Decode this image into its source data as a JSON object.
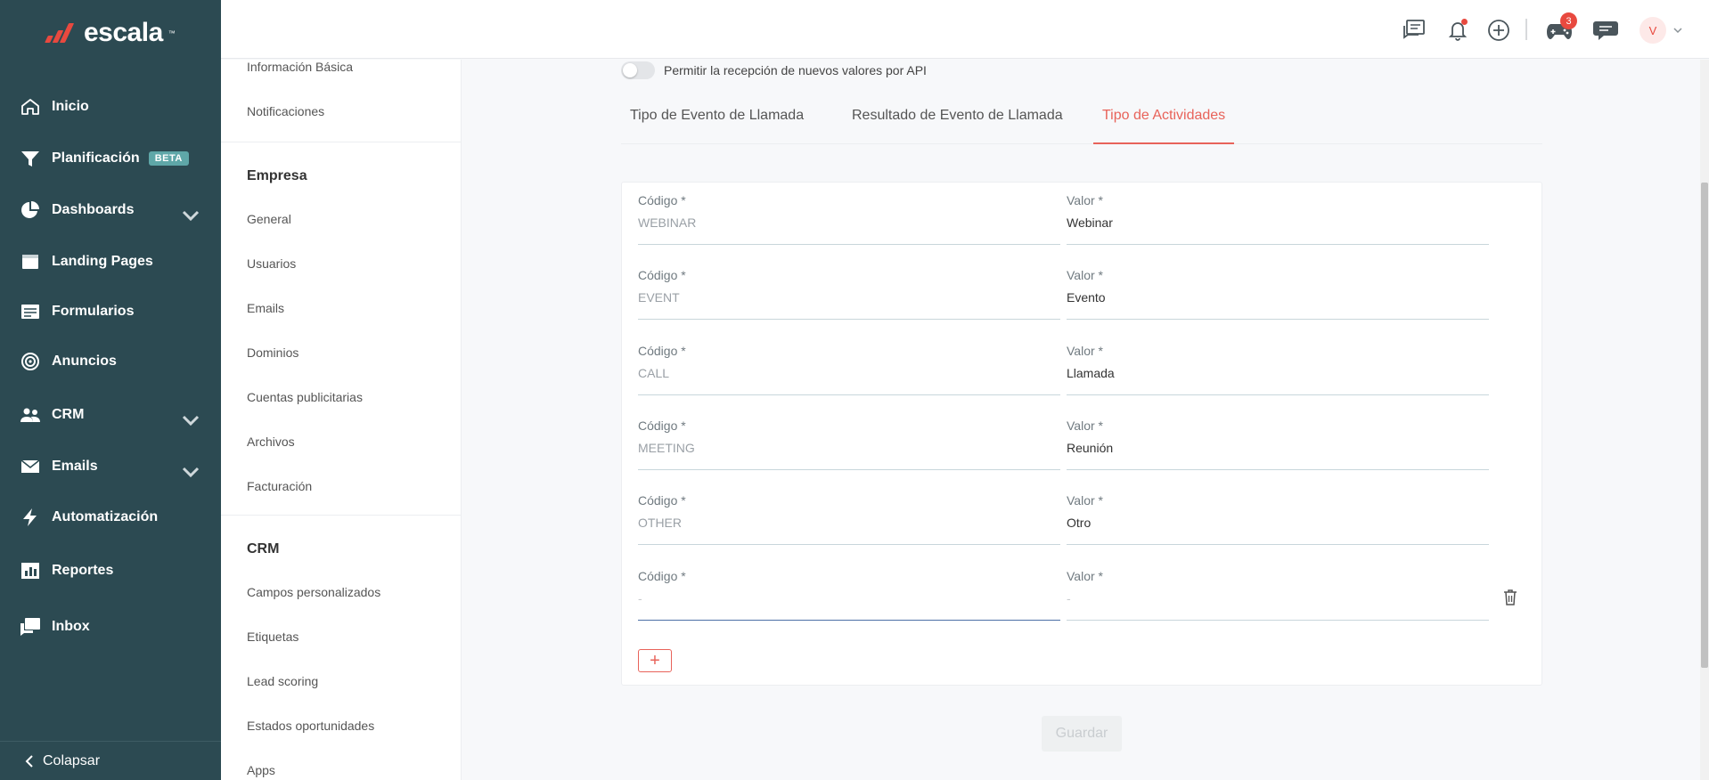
{
  "brand": {
    "name": "escala",
    "tm": "™",
    "accent": "#e8493f",
    "nav_bg": "#2c4a52"
  },
  "nav": {
    "items": [
      {
        "label": "Inicio",
        "icon": "home-icon"
      },
      {
        "label": "Planificación",
        "icon": "funnel-icon",
        "badge": "BETA"
      },
      {
        "label": "Dashboards",
        "icon": "pie-chart-icon",
        "expandable": true
      },
      {
        "label": "Landing Pages",
        "icon": "landing-page-icon"
      },
      {
        "label": "Formularios",
        "icon": "form-icon"
      },
      {
        "label": "Anuncios",
        "icon": "target-icon"
      },
      {
        "label": "CRM",
        "icon": "people-icon",
        "expandable": true
      },
      {
        "label": "Emails",
        "icon": "envelope-icon",
        "expandable": true
      },
      {
        "label": "Automatización",
        "icon": "lightning-icon"
      },
      {
        "label": "Reportes",
        "icon": "bar-chart-icon"
      },
      {
        "label": "Inbox",
        "icon": "chat-bubbles-icon"
      }
    ],
    "collapse_label": "Colapsar"
  },
  "topbar": {
    "icons": [
      "messages-icon",
      "bell-icon",
      "plus-circle-icon",
      "gamepad-icon",
      "support-chat-icon"
    ],
    "gamepad_count": "3",
    "avatar_initial": "V"
  },
  "subnav": {
    "top_items": [
      "Información Básica",
      "Notificaciones"
    ],
    "empresa_heading": "Empresa",
    "empresa_items": [
      "General",
      "Usuarios",
      "Emails",
      "Dominios",
      "Cuentas publicitarias",
      "Archivos",
      "Facturación"
    ],
    "crm_heading": "CRM",
    "crm_items": [
      "Campos personalizados",
      "Etiquetas",
      "Lead scoring",
      "Estados oportunidades",
      "Apps"
    ]
  },
  "main": {
    "toggle_label": "Permitir la recepción de nuevos valores por API",
    "tabs": [
      "Tipo de Evento de Llamada",
      "Resultado de Evento de Llamada",
      "Tipo de Actividades"
    ],
    "active_tab": 2,
    "code_label": "Código *",
    "value_label": "Valor *",
    "rows": [
      {
        "code": "WEBINAR",
        "value": "Webinar"
      },
      {
        "code": "EVENT",
        "value": "Evento"
      },
      {
        "code": "CALL",
        "value": "Llamada"
      },
      {
        "code": "MEETING",
        "value": "Reunión"
      },
      {
        "code": "OTHER",
        "value": "Otro"
      }
    ],
    "new_row": {
      "code_placeholder": "-",
      "value_placeholder": "-"
    },
    "add_label": "+",
    "save_label": "Guardar"
  }
}
